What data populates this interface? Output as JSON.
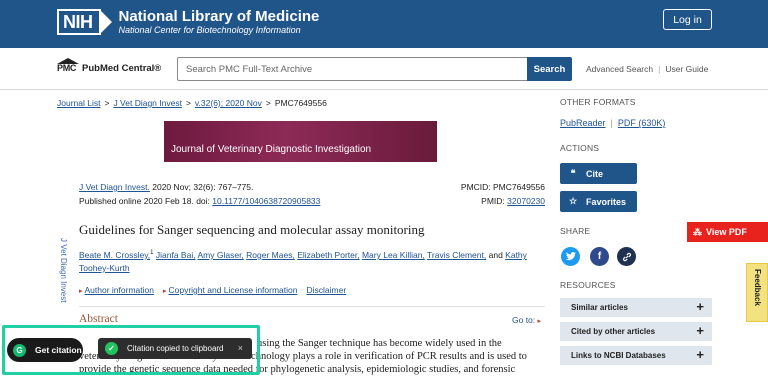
{
  "header": {
    "badge": "NIH",
    "title": "National Library of Medicine",
    "subtitle": "National Center for Biotechnology Information",
    "login_label": "Log in"
  },
  "pmc": {
    "logo_word": "PMC",
    "logo_text": "PubMed Central®",
    "search_placeholder": "Search PMC Full-Text Archive",
    "search_label": "Search",
    "advanced_label": "Advanced Search",
    "guide_label": "User Guide"
  },
  "breadcrumb": {
    "journal_list": "Journal List",
    "journal": "J Vet Diagn Invest",
    "issue": "v.32(6); 2020 Nov",
    "current": "PMC7649556",
    "sep": ">"
  },
  "journal_banner": {
    "title": "Journal of Veterinary Diagnostic Investigation"
  },
  "citation": {
    "journal_link": "J Vet Diagn Invest.",
    "details": "2020 Nov; 32(6): 767–775.",
    "published_prefix": "Published online 2020 Feb 18. doi:",
    "doi": "10.1177/1040638720905833",
    "pmcid": "PMCID: PMC7649556",
    "pmid_prefix": "PMID:",
    "pmid": "32070230"
  },
  "vertical_label": "J Vet Diagn Invest",
  "article": {
    "title": "Guidelines for Sanger sequencing and molecular assay monitoring",
    "authors": [
      "Beate M. Crossley,",
      "Jianfa Bai,",
      "Amy Glaser,",
      "Roger Maes,",
      "Elizabeth Porter,",
      "Mary Lea Killian,",
      "Travis Clement,",
      "Kathy Toohey-Kurth"
    ],
    "author1_sup": "1",
    "and": "and",
    "author_info": "Author information",
    "copyright": "Copyright and License information",
    "disclaimer": "Disclaimer",
    "abstract_heading": "Abstract",
    "goto": "Go to:",
    "abstract_line1": "using the Sanger technique has become widely used in the",
    "abstract_line2": "veterinary diagnostic community. This technology plays a role in verification of PCR results and is used to",
    "abstract_line3": "provide the genetic sequence data needed for phylogenetic analysis, epidemiologic studies, and forensic"
  },
  "sidebar": {
    "other_formats": "OTHER FORMATS",
    "pubreader": "PubReader",
    "pdf": "PDF (630K)",
    "actions": "ACTIONS",
    "cite": "Cite",
    "favorites": "Favorites",
    "share": "SHARE",
    "resources": "RESOURCES",
    "resource_items": [
      "Similar articles",
      "Cited by other articles",
      "Links to NCBI Databases"
    ],
    "plus": "+"
  },
  "view_pdf": "View PDF",
  "feedback": "Feedback",
  "overlay": {
    "get_citation": "Get citation",
    "toast": "Citation copied to clipboard",
    "close": "×"
  },
  "colors": {
    "nih_blue": "#20558a",
    "link_blue": "#205493",
    "pdf_red": "#e8231d",
    "highlight_teal": "#1ed0a3",
    "journal_maroon": "#7c2249"
  }
}
